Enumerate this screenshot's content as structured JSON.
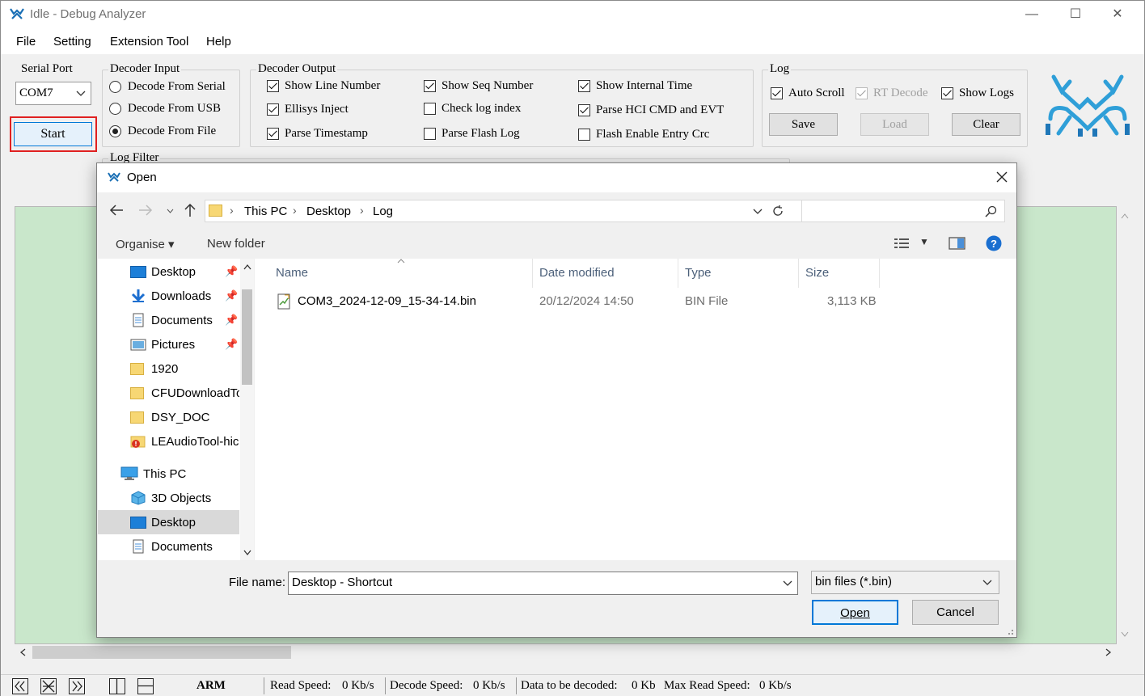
{
  "window": {
    "title": "Idle - Debug Analyzer",
    "min": "—",
    "max": "☐",
    "close": "✕"
  },
  "menu": [
    "File",
    "Setting",
    "Extension Tool",
    "Help"
  ],
  "serial_port": {
    "label": "Serial Port",
    "value": "COM7",
    "start_label": "Start"
  },
  "decoder_input": {
    "label": "Decoder Input",
    "options": [
      {
        "label": "Decode From Serial",
        "selected": false
      },
      {
        "label": "Decode From USB",
        "selected": false
      },
      {
        "label": "Decode From File",
        "selected": true
      }
    ]
  },
  "decoder_output": {
    "label": "Decoder Output",
    "options": [
      {
        "label": "Show Line Number",
        "checked": true
      },
      {
        "label": "Ellisys Inject",
        "checked": true
      },
      {
        "label": "Parse Timestamp",
        "checked": true
      },
      {
        "label": "Show Seq Number",
        "checked": true
      },
      {
        "label": "Check log index",
        "checked": false
      },
      {
        "label": "Parse Flash Log",
        "checked": false
      },
      {
        "label": "Show Internal Time",
        "checked": true
      },
      {
        "label": "Parse HCI CMD and EVT",
        "checked": true
      },
      {
        "label": "Flash Enable Entry Crc",
        "checked": false
      }
    ]
  },
  "log": {
    "label": "Log",
    "auto_scroll": "Auto Scroll",
    "rt_decode": "RT Decode",
    "show_logs": "Show Logs",
    "save": "Save",
    "load": "Load",
    "clear": "Clear"
  },
  "log_filter": {
    "label": "Log Filter"
  },
  "dialog": {
    "title": "Open",
    "breadcrumb": [
      "This PC",
      "Desktop",
      "Log"
    ],
    "organise": "Organise",
    "new_folder": "New folder",
    "nav_items": [
      "Desktop",
      "Downloads",
      "Documents",
      "Pictures",
      "1920",
      "CFUDownloadTo",
      "DSY_DOC",
      "LEAudioTool-hic",
      "This PC",
      "3D Objects",
      "Desktop",
      "Documents"
    ],
    "columns": [
      "Name",
      "Date modified",
      "Type",
      "Size"
    ],
    "files": [
      {
        "name": "COM3_2024-12-09_15-34-14.bin",
        "date": "20/12/2024 14:50",
        "type": "BIN File",
        "size": "3,113 KB"
      }
    ],
    "file_name_label": "File name:",
    "file_name_value": "Desktop - Shortcut",
    "filter": "bin files (*.bin)",
    "open": "Open",
    "cancel": "Cancel"
  },
  "status": {
    "arch": "ARM",
    "read_speed_label": "Read Speed:",
    "read_speed": "0 Kb/s",
    "decode_speed_label": "Decode Speed:",
    "decode_speed": "0 Kb/s",
    "to_decode_label": "Data to be decoded:",
    "to_decode": "0 Kb",
    "max_read_label": "Max Read Speed:",
    "max_read": "0 Kb/s"
  }
}
